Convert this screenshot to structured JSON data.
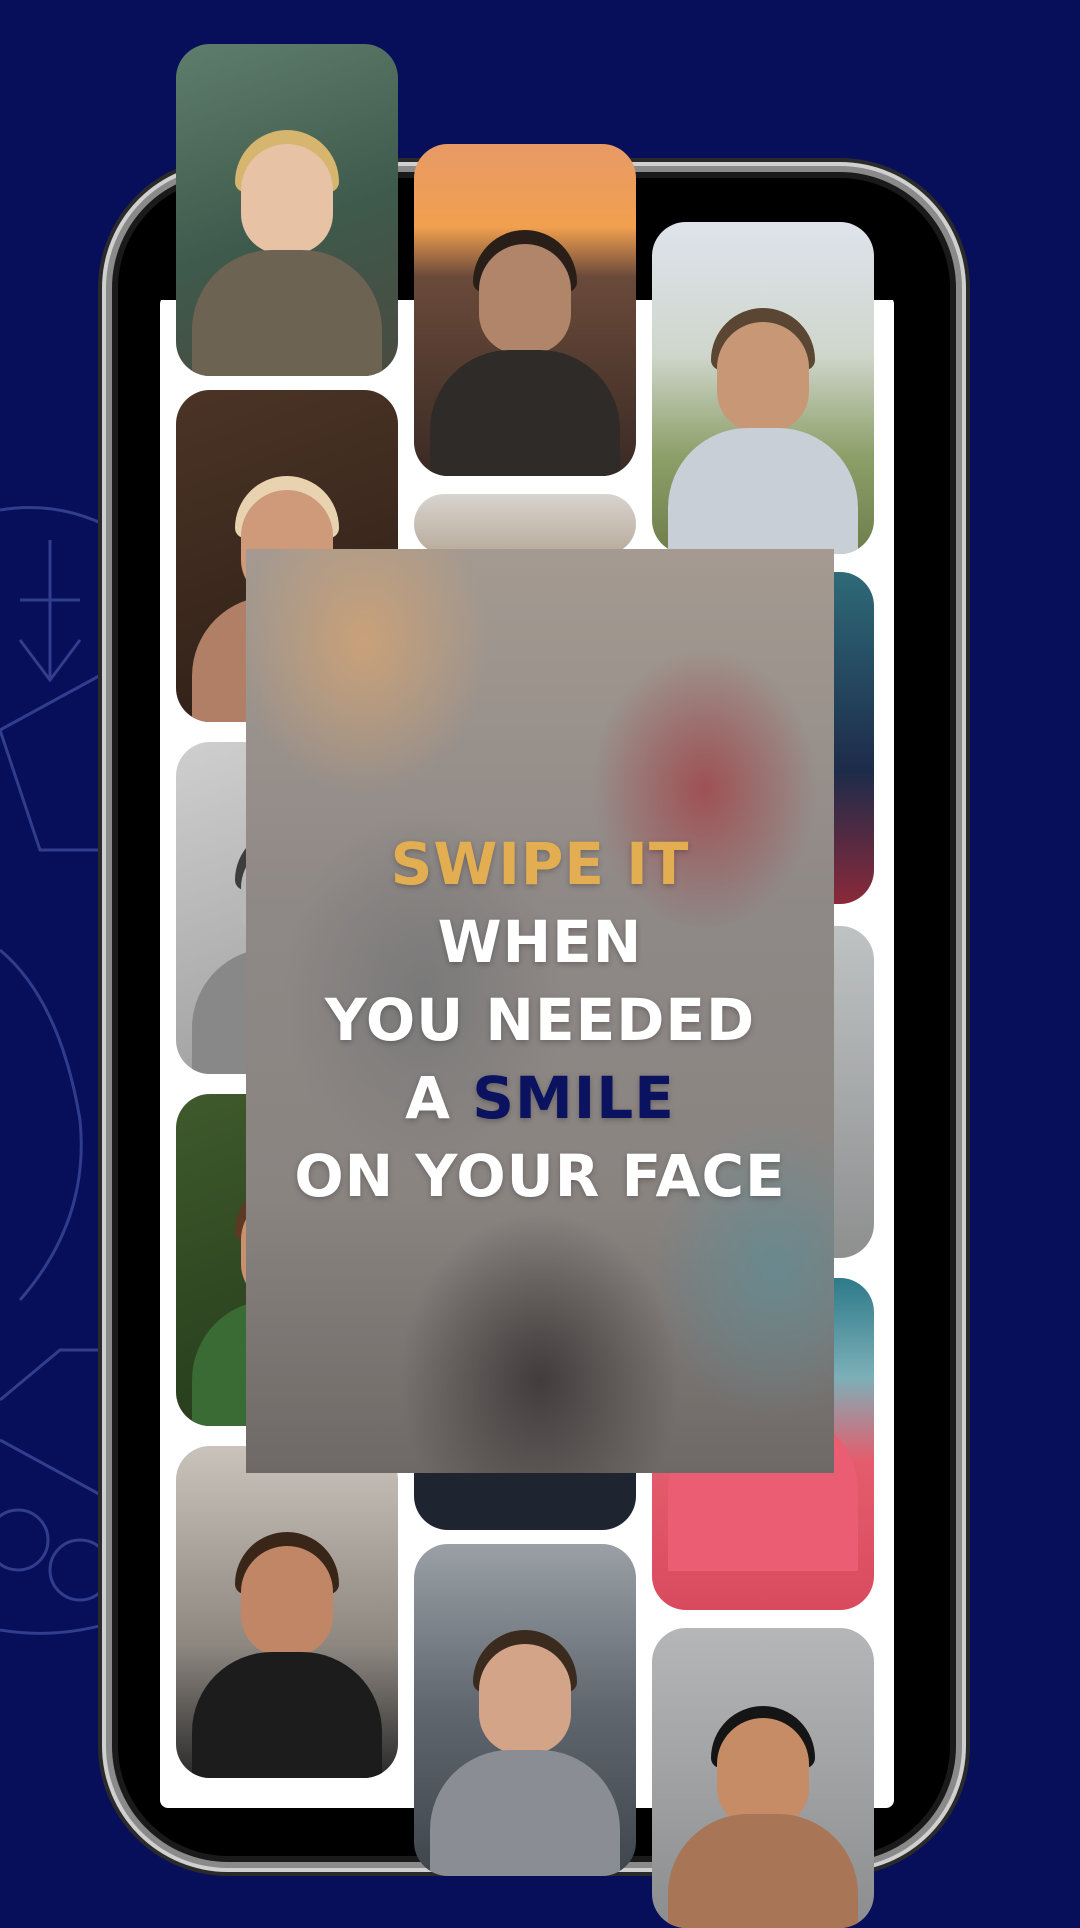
{
  "colors": {
    "background": "#070e5a",
    "accent_gold": "#e3ad52",
    "accent_navy": "#0b1361",
    "text": "#ffffff"
  },
  "headline": {
    "line1": "SWIPE IT",
    "line2": "WHEN",
    "line3": "YOU NEEDED",
    "line4_prefix": "A",
    "line4_highlight": "SMILE",
    "line5": "ON YOUR FACE"
  },
  "photos": [
    {
      "name": "photo-blonde-woman"
    },
    {
      "name": "photo-woman-sunset"
    },
    {
      "name": "photo-man-glasses-grass"
    },
    {
      "name": "photo-woman-headscarf"
    },
    {
      "name": "photo-man-profile-bw"
    },
    {
      "name": "photo-woman-leaves"
    },
    {
      "name": "photo-man-black-tee"
    },
    {
      "name": "photo-man-gray-hoodie"
    },
    {
      "name": "photo-woman-pink-shirt"
    },
    {
      "name": "photo-woman-smiling"
    }
  ]
}
